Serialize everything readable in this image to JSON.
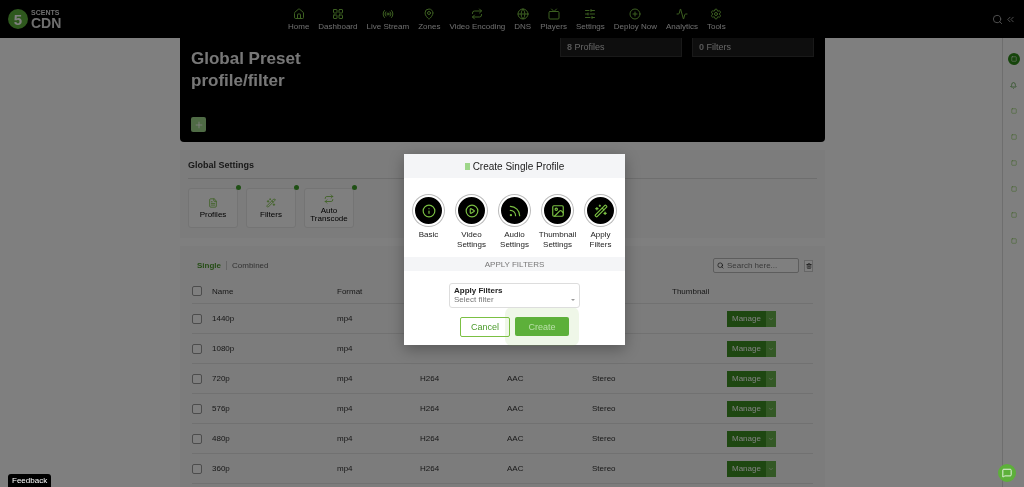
{
  "brand": {
    "badge": "5",
    "top": "SCENTS",
    "bottom": "CDN"
  },
  "nav": [
    {
      "label": "Home"
    },
    {
      "label": "Dashboard"
    },
    {
      "label": "Live Stream"
    },
    {
      "label": "Zones"
    },
    {
      "label": "Video Encoding"
    },
    {
      "label": "DNS"
    },
    {
      "label": "Players"
    },
    {
      "label": "Settings"
    },
    {
      "label": "Deploy Now"
    },
    {
      "label": "Analytics"
    },
    {
      "label": "Tools"
    }
  ],
  "hero": {
    "title": "Global Preset profile/filter",
    "stats": [
      {
        "value": "8",
        "label": "Profiles"
      },
      {
        "value": "0",
        "label": "Filters"
      }
    ]
  },
  "global_settings": {
    "title": "Global Settings",
    "tiles": [
      {
        "label": "Profiles"
      },
      {
        "label": "Filters"
      },
      {
        "label": "Auto Transcode"
      }
    ]
  },
  "table": {
    "tabs": [
      {
        "label": "Single",
        "selected": true
      },
      {
        "label": "Combined",
        "selected": false
      }
    ],
    "search": {
      "placeholder": "Search here..."
    },
    "headers": {
      "name": "Name",
      "format": "Format",
      "thumbnail": "Thumbnail",
      "checked": false
    },
    "rows": [
      {
        "checked": false,
        "name": "1440p",
        "format": "mp4",
        "action": "Manage"
      },
      {
        "checked": false,
        "name": "1080p",
        "format": "mp4",
        "action": "Manage"
      },
      {
        "checked": false,
        "name": "720p",
        "format": "mp4",
        "video": "H264",
        "audio": "AAC",
        "channels": "Stereo",
        "action": "Manage"
      },
      {
        "checked": false,
        "name": "576p",
        "format": "mp4",
        "video": "H264",
        "audio": "AAC",
        "channels": "Stereo",
        "action": "Manage"
      },
      {
        "checked": false,
        "name": "480p",
        "format": "mp4",
        "video": "H264",
        "audio": "AAC",
        "channels": "Stereo",
        "action": "Manage"
      },
      {
        "checked": false,
        "name": "360p",
        "format": "mp4",
        "video": "H264",
        "audio": "AAC",
        "channels": "Stereo",
        "action": "Manage"
      }
    ]
  },
  "feedback": "Feedback",
  "modal": {
    "title": "Create Single Profile",
    "steps": [
      {
        "label": "Basic"
      },
      {
        "label": "Video Settings"
      },
      {
        "label": "Audio Settings"
      },
      {
        "label": "Thumbnail Settings"
      },
      {
        "label": "Apply Filters"
      }
    ],
    "section": "APPLY FILTERS",
    "field": {
      "label": "Apply Filters",
      "placeholder": "Select filter"
    },
    "cancel": "Cancel",
    "create": "Create"
  }
}
